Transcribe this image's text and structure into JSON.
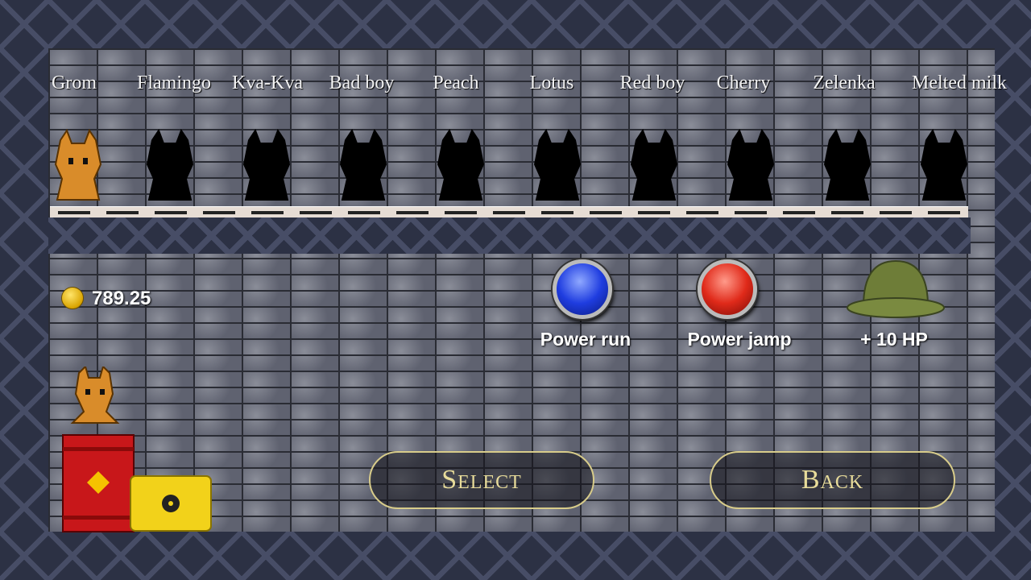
{
  "characters": [
    {
      "name": "Grom",
      "unlocked": true
    },
    {
      "name": "Flamingo",
      "unlocked": false
    },
    {
      "name": "Kva-Kva",
      "unlocked": false
    },
    {
      "name": "Bad boy",
      "unlocked": false
    },
    {
      "name": "Peach",
      "unlocked": false
    },
    {
      "name": "Lotus",
      "unlocked": false
    },
    {
      "name": "Red boy",
      "unlocked": false
    },
    {
      "name": "Cherry",
      "unlocked": false
    },
    {
      "name": "Zelenka",
      "unlocked": false
    },
    {
      "name": "Melted milk",
      "unlocked": false
    }
  ],
  "coins": {
    "value": "789.25",
    "icon": "coin-icon"
  },
  "powerups": [
    {
      "label": "Power run",
      "icon": "blue-orb-icon",
      "color": "#1f3de0"
    },
    {
      "label": "Power jamp",
      "icon": "red-orb-icon",
      "color": "#e02a1a"
    },
    {
      "label": "+ 10 HP",
      "icon": "helmet-icon",
      "color": "#6b7a35"
    }
  ],
  "buttons": {
    "select": "Select",
    "back": "Back"
  },
  "colors": {
    "char": "#d98c2a",
    "button_text": "#e8dc9a"
  }
}
